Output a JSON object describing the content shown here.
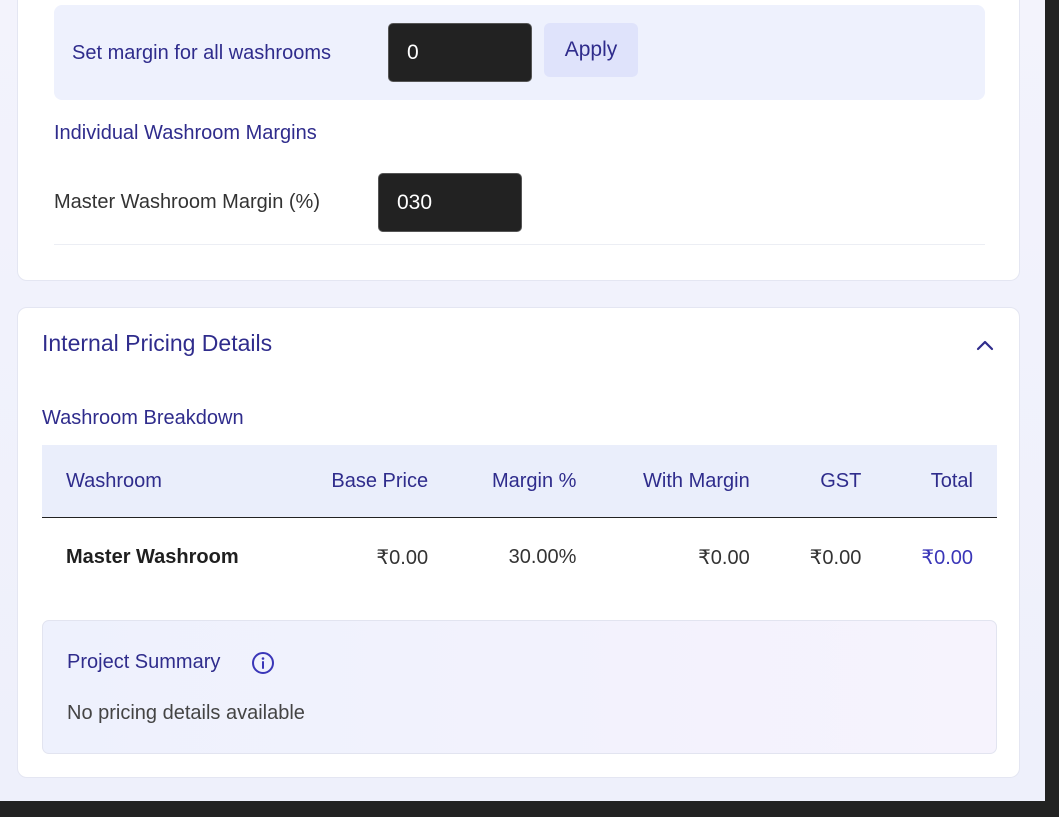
{
  "global_margin": {
    "label": "Set margin for all washrooms",
    "value": "0",
    "apply_label": "Apply"
  },
  "individual": {
    "heading": "Individual Washroom Margins",
    "rows": [
      {
        "label": "Master Washroom Margin (%)",
        "value": "030"
      }
    ]
  },
  "pricing": {
    "title": "Internal Pricing Details",
    "toggle_icon": "chevron-up-icon",
    "breakdown_heading": "Washroom Breakdown",
    "columns": [
      "Washroom",
      "Base Price",
      "Margin %",
      "With Margin",
      "GST",
      "Total"
    ],
    "rows": [
      {
        "washroom": "Master Washroom",
        "base_price": "₹0.00",
        "margin_pct": "30.00%",
        "with_margin": "₹0.00",
        "gst": "₹0.00",
        "total": "₹0.00"
      }
    ]
  },
  "summary": {
    "title": "Project Summary",
    "info_icon": "info-icon",
    "empty_text": "No pricing details available"
  },
  "colors": {
    "accent": "#2f2c8c",
    "total_highlight": "#3a36b8",
    "input_bg": "#222222",
    "button_bg": "#dfe3fb"
  }
}
